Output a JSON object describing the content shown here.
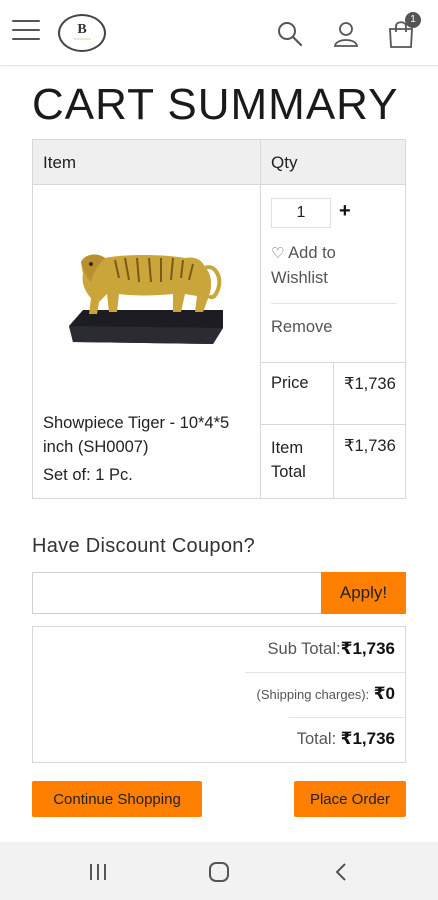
{
  "header": {
    "logo_letter": "B",
    "logo_sub": "Brass Heritage",
    "cart_count": "1"
  },
  "page": {
    "title": "CART SUMMARY"
  },
  "table": {
    "col_item": "Item",
    "col_qty": "Qty"
  },
  "product": {
    "name": "Showpiece Tiger - 10*4*5 inch (SH0007)",
    "set": "Set of: 1 Pc.",
    "qty": "1",
    "plus_label": "+",
    "wishlist_label": "Add to Wishlist",
    "remove_label": "Remove",
    "price_label": "Price",
    "price_value": "₹1,736",
    "item_total_label": "Item Total",
    "item_total_value": "₹1,736"
  },
  "coupon": {
    "heading": "Have Discount Coupon?",
    "value": "",
    "apply_label": "Apply!"
  },
  "totals": {
    "subtotal_label": "Sub Total:",
    "subtotal_value": "₹1,736",
    "shipping_label": "(Shipping charges):",
    "shipping_value": "₹0",
    "total_label": "Total:",
    "total_value": "₹1,736"
  },
  "actions": {
    "continue_label": "Continue Shopping",
    "place_order_label": "Place Order"
  },
  "colors": {
    "accent": "#ff7f00",
    "header_row": "#efefef",
    "navbar": "#f2f2f2"
  },
  "icons": {
    "menu": "hamburger-icon",
    "search": "search-icon",
    "account": "user-icon",
    "cart": "shopping-bag-icon",
    "wishlist": "heart-icon",
    "nav_recents": "recents-icon",
    "nav_home": "home-icon",
    "nav_back": "back-icon"
  }
}
